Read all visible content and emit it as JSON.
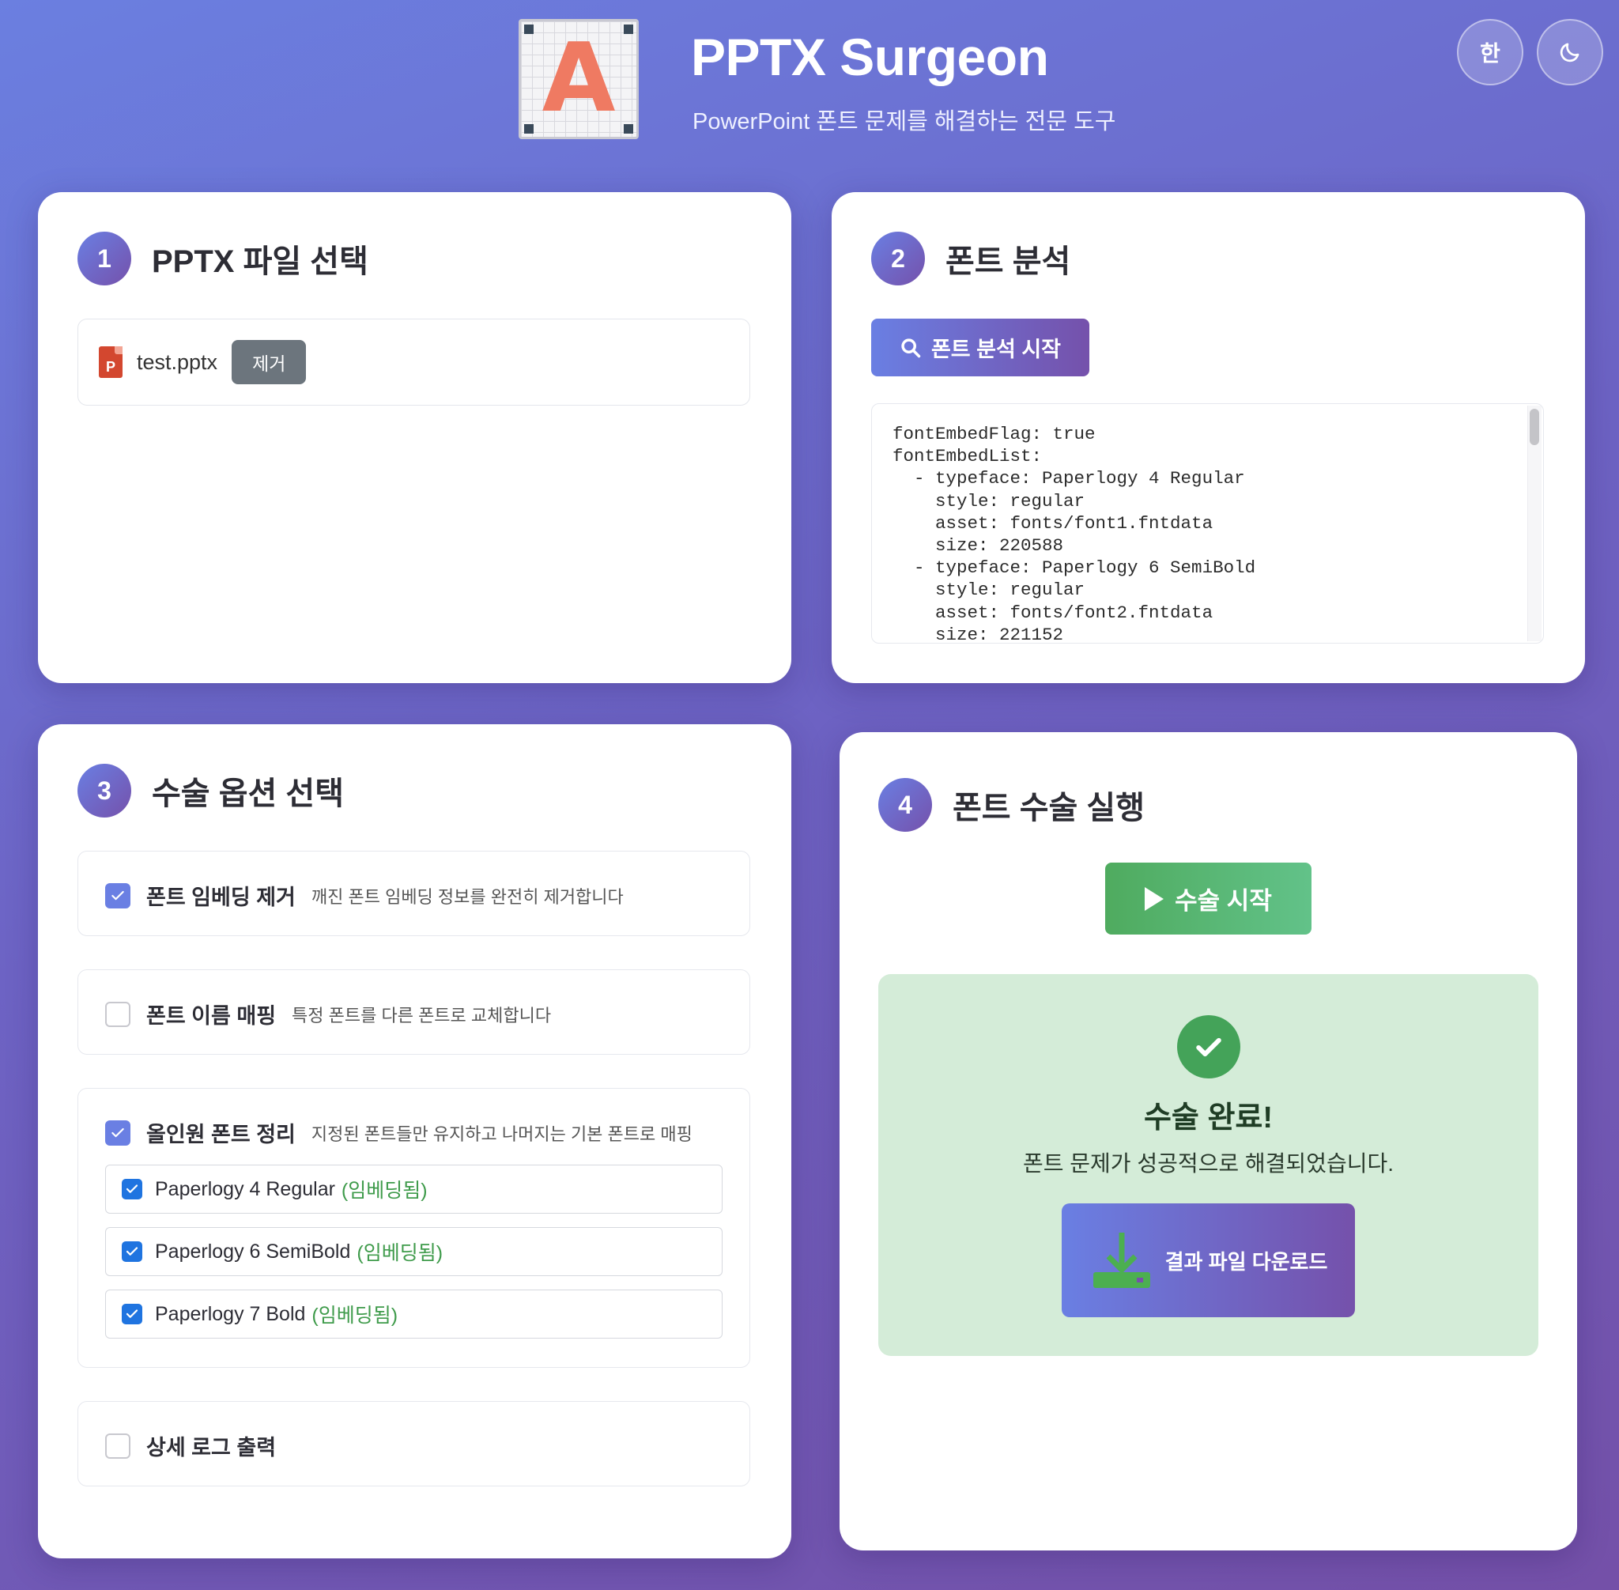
{
  "header": {
    "logo_letter": "A",
    "title": "PPTX Surgeon",
    "subtitle": "PowerPoint 폰트 문제를 해결하는 전문 도구",
    "lang_button": "한",
    "theme_icon": "moon-icon"
  },
  "step1": {
    "number": "1",
    "title": "PPTX 파일 선택",
    "file_icon_letter": "P",
    "file_name": "test.pptx",
    "remove_label": "제거"
  },
  "step2": {
    "number": "2",
    "title": "폰트 분석",
    "analyze_label": "폰트 분석 시작",
    "log": "fontEmbedFlag: true\nfontEmbedList:\n  - typeface: Paperlogy 4 Regular\n    style: regular\n    asset: fonts/font1.fntdata\n    size: 220588\n  - typeface: Paperlogy 6 SemiBold\n    style: regular\n    asset: fonts/font2.fntdata\n    size: 221152"
  },
  "step3": {
    "number": "3",
    "title": "수술 옵션 선택",
    "options": [
      {
        "label": "폰트 임베딩 제거",
        "desc": "깨진 폰트 임베딩 정보를 완전히 제거합니다",
        "checked": true
      },
      {
        "label": "폰트 이름 매핑",
        "desc": "특정 폰트를 다른 폰트로 교체합니다",
        "checked": false
      },
      {
        "label": "올인원 폰트 정리",
        "desc": "지정된 폰트들만 유지하고 나머지는 기본 폰트로 매핑",
        "checked": true
      },
      {
        "label": "상세 로그 출력",
        "desc": "",
        "checked": false
      }
    ],
    "fonts": [
      {
        "name": "Paperlogy 4 Regular",
        "tag": "(임베딩됨)",
        "checked": true
      },
      {
        "name": "Paperlogy 6 SemiBold",
        "tag": "(임베딩됨)",
        "checked": true
      },
      {
        "name": "Paperlogy 7 Bold",
        "tag": "(임베딩됨)",
        "checked": true
      }
    ]
  },
  "step4": {
    "number": "4",
    "title": "폰트 수술 실행",
    "run_label": "수술 시작",
    "done_title": "수술 완료!",
    "done_text": "폰트 문제가 성공적으로 해결되었습니다.",
    "download_label": "결과 파일 다운로드"
  },
  "colors": {
    "accent": "#6a7fe3",
    "accent_dark": "#7551ab",
    "success": "#44a359",
    "success_bg": "#d4ecd8",
    "remove_gray": "#6c757d",
    "embedded_tag": "#3f9b4b"
  }
}
